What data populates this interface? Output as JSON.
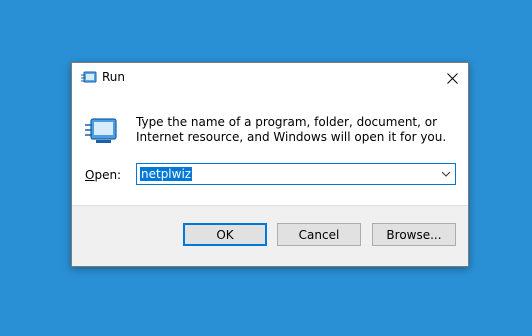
{
  "dialog": {
    "title": "Run",
    "description": "Type the name of a program, folder, document, or Internet resource, and Windows will open it for you.",
    "open_label_key": "O",
    "open_label_rest": "pen:",
    "input_value": "netplwiz",
    "buttons": {
      "ok": "OK",
      "cancel": "Cancel",
      "browse": "Browse..."
    }
  },
  "colors": {
    "desktop": "#2a90d6",
    "accent": "#0078d7",
    "footer": "#f0f0f0"
  },
  "icons": {
    "title": "run-icon",
    "content": "run-icon",
    "close": "close-icon",
    "dropdown": "chevron-down-icon"
  }
}
